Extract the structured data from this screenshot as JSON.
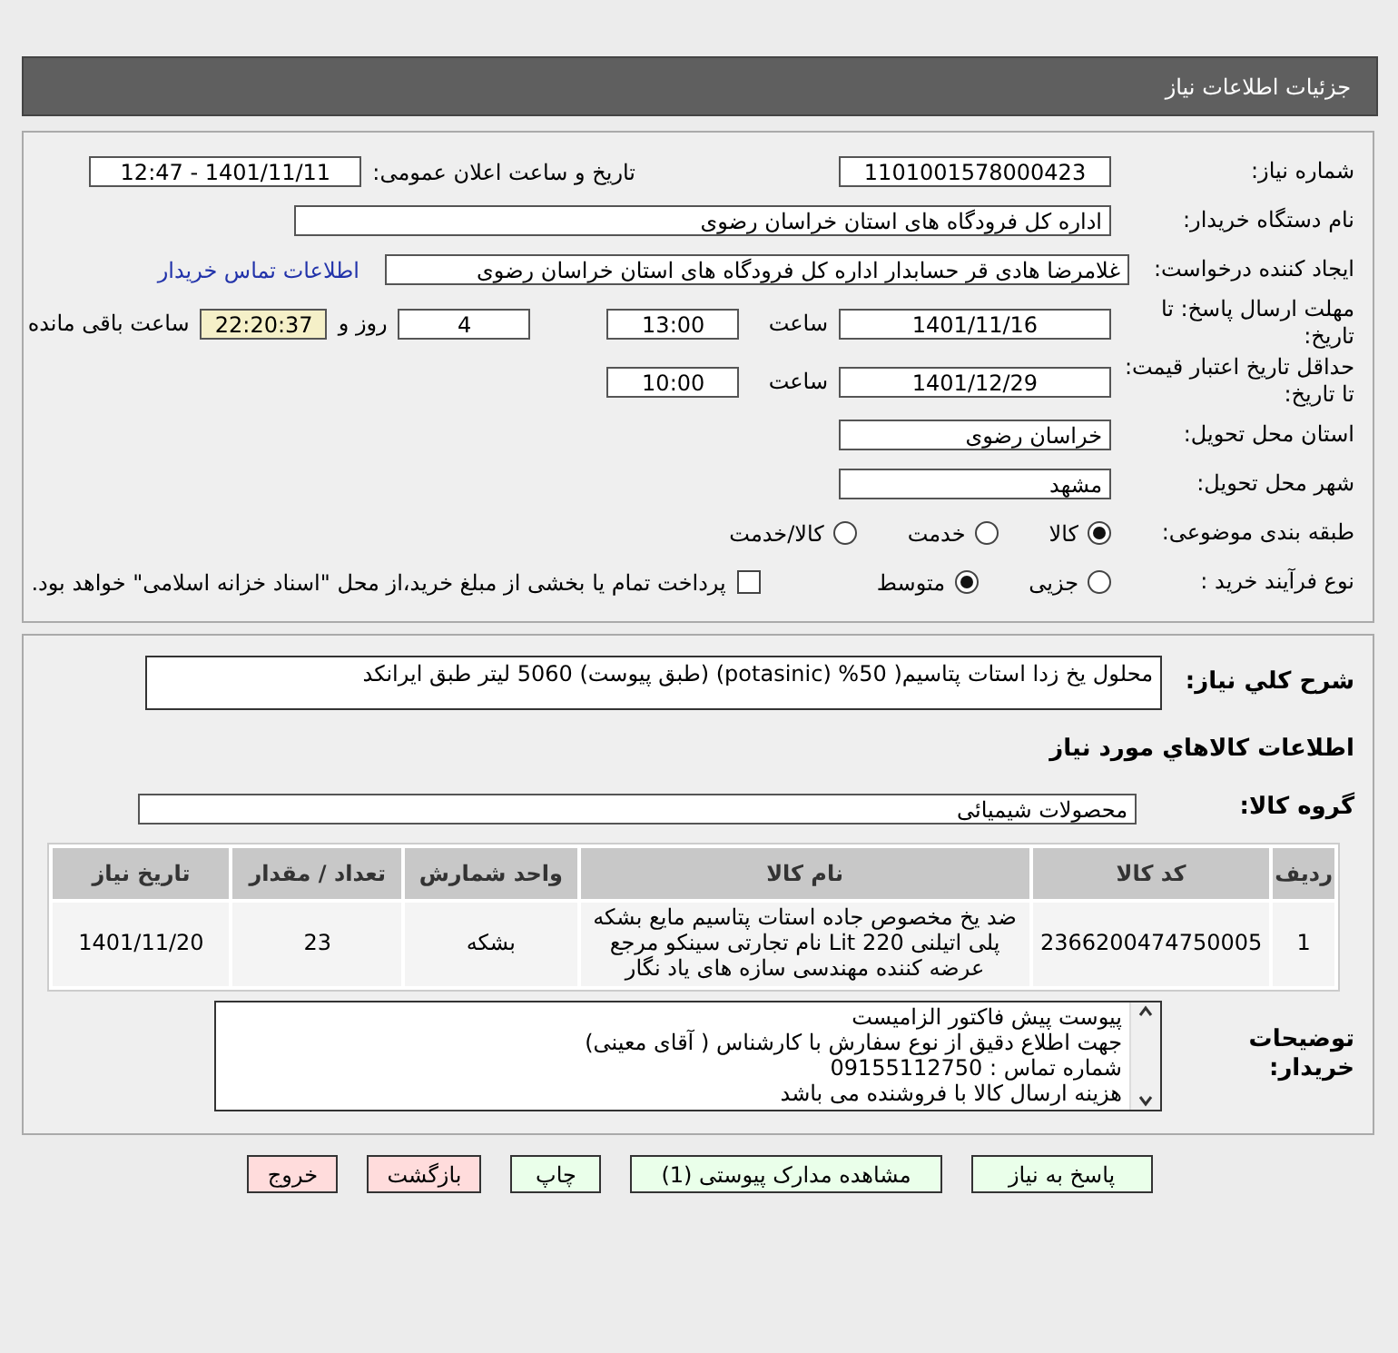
{
  "header": {
    "title": "جزئیات اطلاعات نیاز"
  },
  "need_info": {
    "need_number": {
      "label": "شماره نیاز:",
      "value": "1101001578000423"
    },
    "announce": {
      "label": "تاریخ و ساعت اعلان عمومی:",
      "value": "1401/11/11 - 12:47"
    },
    "buyer_org": {
      "label": "نام دستگاه خریدار:",
      "value": "اداره کل فرودگاه های استان خراسان رضوی"
    },
    "requester": {
      "label": "ایجاد کننده درخواست:",
      "value": "غلامرضا هادی قر حسابدار اداره کل فرودگاه های استان خراسان رضوی",
      "link": "اطلاعات تماس خریدار"
    },
    "reply_deadline": {
      "label": "مهلت ارسال پاسخ: تا تاریخ:",
      "date": "1401/11/16",
      "time_label": "ساعت",
      "time": "13:00",
      "days": "4",
      "days_label": "روز و",
      "remaining": "22:20:37",
      "remaining_label": "ساعت باقی مانده"
    },
    "price_validity": {
      "label": "حداقل تاریخ اعتبار قیمت: تا تاریخ:",
      "date": "1401/12/29",
      "time_label": "ساعت",
      "time": "10:00"
    },
    "province": {
      "label": "استان محل تحویل:",
      "value": "خراسان رضوی"
    },
    "city": {
      "label": "شهر محل تحویل:",
      "value": "مشهد"
    },
    "category": {
      "label": "طبقه بندی موضوعی:",
      "options": [
        {
          "label": "کالا",
          "selected": true
        },
        {
          "label": "خدمت",
          "selected": false
        },
        {
          "label": "کالا/خدمت",
          "selected": false
        }
      ]
    },
    "purchase_type": {
      "label": "نوع فرآیند خرید :",
      "options": [
        {
          "label": "جزیی",
          "selected": false
        },
        {
          "label": "متوسط",
          "selected": true
        }
      ],
      "payment_note": {
        "label": "پرداخت تمام یا بخشی از مبلغ خرید،از محل \"اسناد خزانه اسلامی\" خواهد بود.",
        "checked": false
      }
    }
  },
  "goods": {
    "description": {
      "label": "شرح کلي نياز:",
      "value": "محلول یخ زدا  استات پتاسیم( 50% (potasinic)  (طبق پیوست) 5060 لیتر  طبق ایرانکد"
    },
    "section_title": "اطلاعات کالاهاي مورد نياز",
    "group": {
      "label": "گروه کالا:",
      "value": "محصولات شیمیائی"
    },
    "table": {
      "columns": [
        "ردیف",
        "کد کالا",
        "نام کالا",
        "واحد شمارش",
        "تعداد / مقدار",
        "تاریخ نیاز"
      ],
      "rows": [
        [
          "1",
          "2366200474750005",
          "ضد یخ مخصوص جاده استات پتاسیم مایع بشکه پلی اتیلنی 220 Lit نام تجارتی سینکو مرجع عرضه کننده مهندسی سازه های یاد نگار",
          "بشکه",
          "23",
          "1401/11/20"
        ]
      ]
    },
    "buyer_notes": {
      "label": "توضیحات خریدار:",
      "lines": [
        "پیوست پیش فاکتور الزامیست",
        "جهت اطلاع دقیق از نوع سفارش با کارشناس  ( آقای معینی)",
        "شماره تماس :  09155112750",
        "هزینه ارسال کالا با فروشنده می باشد"
      ]
    }
  },
  "buttons": [
    {
      "label": "پاسخ به نیاز",
      "kind": "action"
    },
    {
      "label": "مشاهده مدارک پیوستی (1)",
      "kind": "action"
    },
    {
      "label": "چاپ",
      "kind": "action"
    },
    {
      "label": "بازگشت",
      "kind": "exit"
    },
    {
      "label": "خروج",
      "kind": "exit"
    }
  ]
}
